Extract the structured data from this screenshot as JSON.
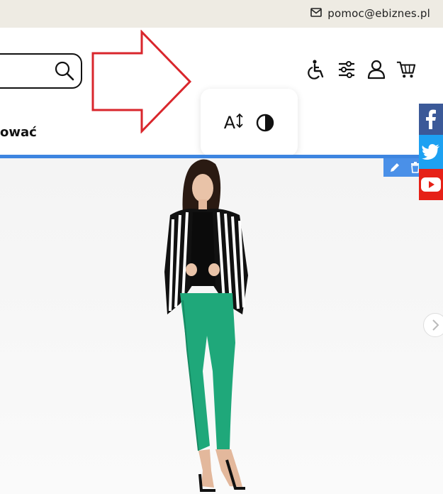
{
  "topbar": {
    "email": "pomoc@ebiznes.pl",
    "mail_icon": "envelope-icon"
  },
  "header": {
    "search_icon": "search-icon",
    "icons": [
      "wheelchair-icon",
      "sliders-icon",
      "user-icon",
      "cart-icon"
    ],
    "nav_partial": "ować"
  },
  "a11y_popup": {
    "font_size_label": "A",
    "icons": [
      "font-size-icon",
      "contrast-icon"
    ]
  },
  "annotation": {
    "arrow_color": "#d9262c"
  },
  "edit_bar": {
    "icons": [
      "pencil-icon",
      "trash-icon"
    ]
  },
  "social": [
    "facebook-icon",
    "twitter-icon",
    "youtube-icon"
  ],
  "colors": {
    "accent": "#3d85e0",
    "topbar_bg": "#eeebe3",
    "facebook": "#3b5998",
    "twitter": "#1da1f2",
    "youtube": "#e62117"
  }
}
